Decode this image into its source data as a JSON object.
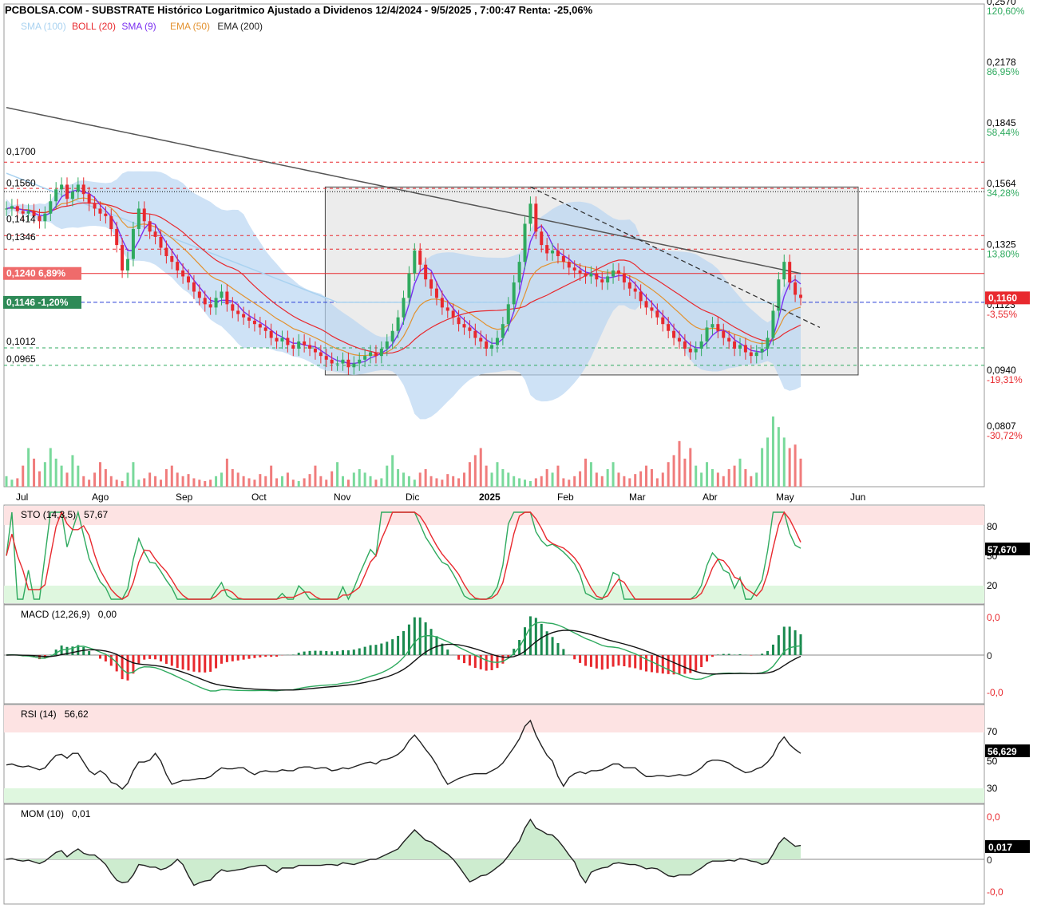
{
  "header": {
    "title": "PCBOLSA.COM - SUBSTRATE Histórico Logaritmico Ajustado a Dividenos 12/4/2024 - 9/5/2025 , 7:00:47 Renta: -25,06%"
  },
  "legend": [
    {
      "label": "SMA (100)",
      "color": "#a9d2f0"
    },
    {
      "label": "BOLL (20)",
      "color": "#e8292e"
    },
    {
      "label": "SMA (9)",
      "color": "#7a2ff0"
    },
    {
      "label": "EMA (50)",
      "color": "#e3912e"
    },
    {
      "label": "EMA (200)",
      "color": "#333333"
    }
  ],
  "colors": {
    "up": "#2faa5f",
    "down": "#e8292e",
    "up_volume": "#79d99b",
    "down_volume": "#f07c7c",
    "bollinger_fill": "#b9d5f2",
    "ema200": "#555555",
    "ema50": "#e3912e",
    "sma9": "#7a2ff0",
    "boll_mid": "#e8292e",
    "sma100": "#a9d2f0",
    "grid_dashed_red": "#e8292e",
    "grid_dashed_green": "#2faa5f",
    "box_fill": "#ececec"
  },
  "chart_data": {
    "type": "candlestick",
    "x_months": [
      "Jul",
      "Ago",
      "Sep",
      "Oct",
      "Nov",
      "Dic",
      "2025",
      "Feb",
      "Mar",
      "Abr",
      "May",
      "Jun"
    ],
    "y_scale": "log",
    "ylim": [
      0.0807,
      0.257
    ],
    "price_ticks": [
      {
        "value": 0.257,
        "label": "0,2570",
        "pct": "120,60%",
        "pct_color": "#2faa5f"
      },
      {
        "value": 0.2178,
        "label": "0,2178",
        "pct": "86,95%",
        "pct_color": "#2faa5f"
      },
      {
        "value": 0.1845,
        "label": "0,1845",
        "pct": "58,44%",
        "pct_color": "#2faa5f"
      },
      {
        "value": 0.1564,
        "label": "0,1564",
        "pct": "34,28%",
        "pct_color": "#2faa5f"
      },
      {
        "value": 0.1325,
        "label": "0,1325",
        "pct": "13,80%",
        "pct_color": "#2faa5f"
      },
      {
        "value": 0.1123,
        "label": "0,1123",
        "pct": "-3,55%",
        "pct_color": "#e8292e"
      },
      {
        "value": 0.094,
        "label": "0,0940",
        "pct": "-19,31%",
        "pct_color": "#e8292e"
      },
      {
        "value": 0.0807,
        "label": "0,0807",
        "pct": "-30,72%",
        "pct_color": "#e8292e"
      }
    ],
    "left_levels": [
      {
        "value": 0.17,
        "label": "0,1700"
      },
      {
        "value": 0.156,
        "label": "0,1560"
      },
      {
        "value": 0.1414,
        "label": "0,1414"
      },
      {
        "value": 0.1346,
        "label": "0,1346"
      },
      {
        "value": 0.1012,
        "label": "0,1012"
      },
      {
        "value": 0.0965,
        "label": "0,0965"
      }
    ],
    "tag_red": {
      "value": 0.124,
      "label": "0,1240",
      "pct": "6,89%"
    },
    "tag_green": {
      "value": 0.1146,
      "label": "0,1146",
      "pct": "-1,20%"
    },
    "current_price": {
      "value": 0.116,
      "label": "0,1160"
    },
    "box": {
      "from_month": 3.8,
      "to_month": 11.0,
      "top": 0.157,
      "bottom": 0.094
    },
    "close": [
      0.148,
      0.149,
      0.147,
      0.146,
      0.147,
      0.145,
      0.143,
      0.146,
      0.151,
      0.156,
      0.158,
      0.152,
      0.155,
      0.158,
      0.154,
      0.15,
      0.148,
      0.146,
      0.145,
      0.14,
      0.134,
      0.125,
      0.129,
      0.14,
      0.148,
      0.143,
      0.139,
      0.137,
      0.133,
      0.13,
      0.128,
      0.125,
      0.123,
      0.121,
      0.118,
      0.116,
      0.114,
      0.113,
      0.116,
      0.118,
      0.114,
      0.112,
      0.111,
      0.11,
      0.109,
      0.108,
      0.107,
      0.106,
      0.104,
      0.103,
      0.104,
      0.102,
      0.101,
      0.103,
      0.102,
      0.101,
      0.1,
      0.099,
      0.098,
      0.097,
      0.097,
      0.098,
      0.096,
      0.097,
      0.098,
      0.099,
      0.1,
      0.099,
      0.101,
      0.103,
      0.106,
      0.11,
      0.116,
      0.124,
      0.132,
      0.127,
      0.122,
      0.119,
      0.116,
      0.113,
      0.112,
      0.11,
      0.108,
      0.107,
      0.106,
      0.104,
      0.103,
      0.101,
      0.102,
      0.104,
      0.108,
      0.114,
      0.121,
      0.128,
      0.142,
      0.15,
      0.139,
      0.134,
      0.131,
      0.132,
      0.13,
      0.128,
      0.126,
      0.125,
      0.124,
      0.123,
      0.124,
      0.122,
      0.121,
      0.123,
      0.125,
      0.124,
      0.121,
      0.119,
      0.118,
      0.115,
      0.113,
      0.112,
      0.11,
      0.108,
      0.106,
      0.104,
      0.103,
      0.101,
      0.1,
      0.101,
      0.103,
      0.107,
      0.108,
      0.106,
      0.104,
      0.103,
      0.101,
      0.102,
      0.1,
      0.099,
      0.1,
      0.101,
      0.104,
      0.112,
      0.122,
      0.128,
      0.121,
      0.117,
      0.116
    ],
    "volume": [
      0.15,
      0.1,
      0.12,
      0.3,
      0.55,
      0.4,
      0.22,
      0.35,
      0.55,
      0.4,
      0.3,
      0.2,
      0.45,
      0.3,
      0.15,
      0.1,
      0.2,
      0.35,
      0.25,
      0.15,
      0.1,
      0.08,
      0.2,
      0.35,
      0.1,
      0.12,
      0.2,
      0.15,
      0.1,
      0.25,
      0.3,
      0.2,
      0.15,
      0.18,
      0.12,
      0.1,
      0.08,
      0.1,
      0.15,
      0.2,
      0.4,
      0.25,
      0.2,
      0.15,
      0.12,
      0.1,
      0.18,
      0.15,
      0.3,
      0.12,
      0.15,
      0.2,
      0.1,
      0.08,
      0.12,
      0.18,
      0.3,
      0.15,
      0.1,
      0.22,
      0.35,
      0.15,
      0.1,
      0.2,
      0.25,
      0.2,
      0.15,
      0.1,
      0.12,
      0.3,
      0.45,
      0.25,
      0.2,
      0.15,
      0.1,
      0.2,
      0.25,
      0.15,
      0.12,
      0.1,
      0.18,
      0.15,
      0.12,
      0.2,
      0.35,
      0.45,
      0.55,
      0.3,
      0.2,
      0.35,
      0.25,
      0.2,
      0.15,
      0.12,
      0.1,
      0.08,
      0.12,
      0.15,
      0.25,
      0.2,
      0.3,
      0.12,
      0.1,
      0.15,
      0.22,
      0.4,
      0.35,
      0.2,
      0.15,
      0.25,
      0.35,
      0.2,
      0.15,
      0.12,
      0.18,
      0.22,
      0.3,
      0.25,
      0.12,
      0.2,
      0.35,
      0.45,
      0.65,
      0.4,
      0.55,
      0.3,
      0.2,
      0.35,
      0.25,
      0.2,
      0.15,
      0.25,
      0.3,
      0.4,
      0.25,
      0.15,
      0.2,
      0.55,
      0.7,
      1.0,
      0.85,
      0.7,
      0.55,
      0.6,
      0.4
    ],
    "sto_levels": [
      80,
      50,
      20
    ],
    "sto_value": "57,670",
    "rsi_levels": [
      70,
      50,
      30
    ],
    "rsi_value": "56,629",
    "mom_value": "0,017",
    "macd_ticks": [
      "0,0",
      "0",
      "-0,0"
    ],
    "mom_ticks": [
      "0,0",
      "0",
      "-0,0"
    ]
  },
  "panels": {
    "sto": {
      "label": "STO (14,3,5)",
      "value": "57,67"
    },
    "macd": {
      "label": "MACD (12,26,9)",
      "value": "0,00"
    },
    "rsi": {
      "label": "RSI (14)",
      "value": "56,62"
    },
    "mom": {
      "label": "MOM (10)",
      "value": "0,01"
    }
  }
}
